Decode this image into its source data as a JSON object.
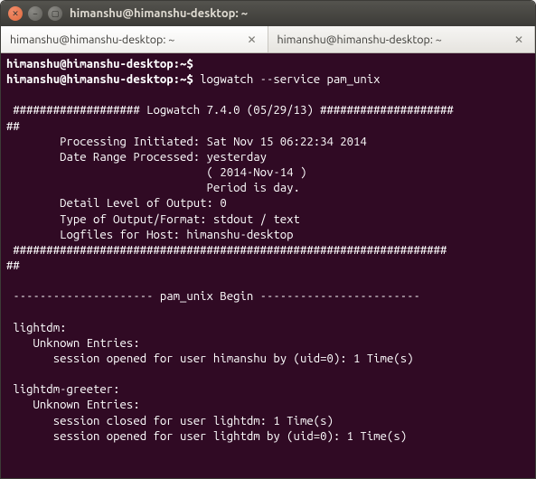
{
  "window": {
    "title": "himanshu@himanshu-desktop: ~"
  },
  "tabs": [
    {
      "label": "himanshu@himanshu-desktop: ~"
    },
    {
      "label": "himanshu@himanshu-desktop: ~"
    }
  ],
  "term": {
    "prompt1": "himanshu@himanshu-desktop:~$",
    "prompt2": "himanshu@himanshu-desktop:~$",
    "command": " logwatch --service pam_unix",
    "blank": " ",
    "header_line": " ################### Logwatch 7.4.0 (05/29/13) ####################",
    "hashcont1": "##",
    "proc_init": "        Processing Initiated: Sat Nov 15 06:22:34 2014",
    "date_range": "        Date Range Processed: yesterday",
    "date_range2": "                              ( 2014-Nov-14 )",
    "period": "                              Period is day.",
    "detail": "        Detail Level of Output: 0",
    "outfmt": "        Type of Output/Format: stdout / text",
    "logfiles": "        Logfiles for Host: himanshu-desktop",
    "footer_hash": " #################################################################",
    "hashcont2": "##",
    "pam_begin": " --------------------- pam_unix Begin ------------------------ ",
    "lightdm": " lightdm:",
    "unknown1": "    Unknown Entries:",
    "sess1": "       session opened for user himanshu by (uid=0): 1 Time(s)",
    "greeter": " lightdm-greeter:",
    "unknown2": "    Unknown Entries:",
    "sess2": "       session closed for user lightdm: 1 Time(s)",
    "sess3": "       session opened for user lightdm by (uid=0): 1 Time(s)"
  }
}
